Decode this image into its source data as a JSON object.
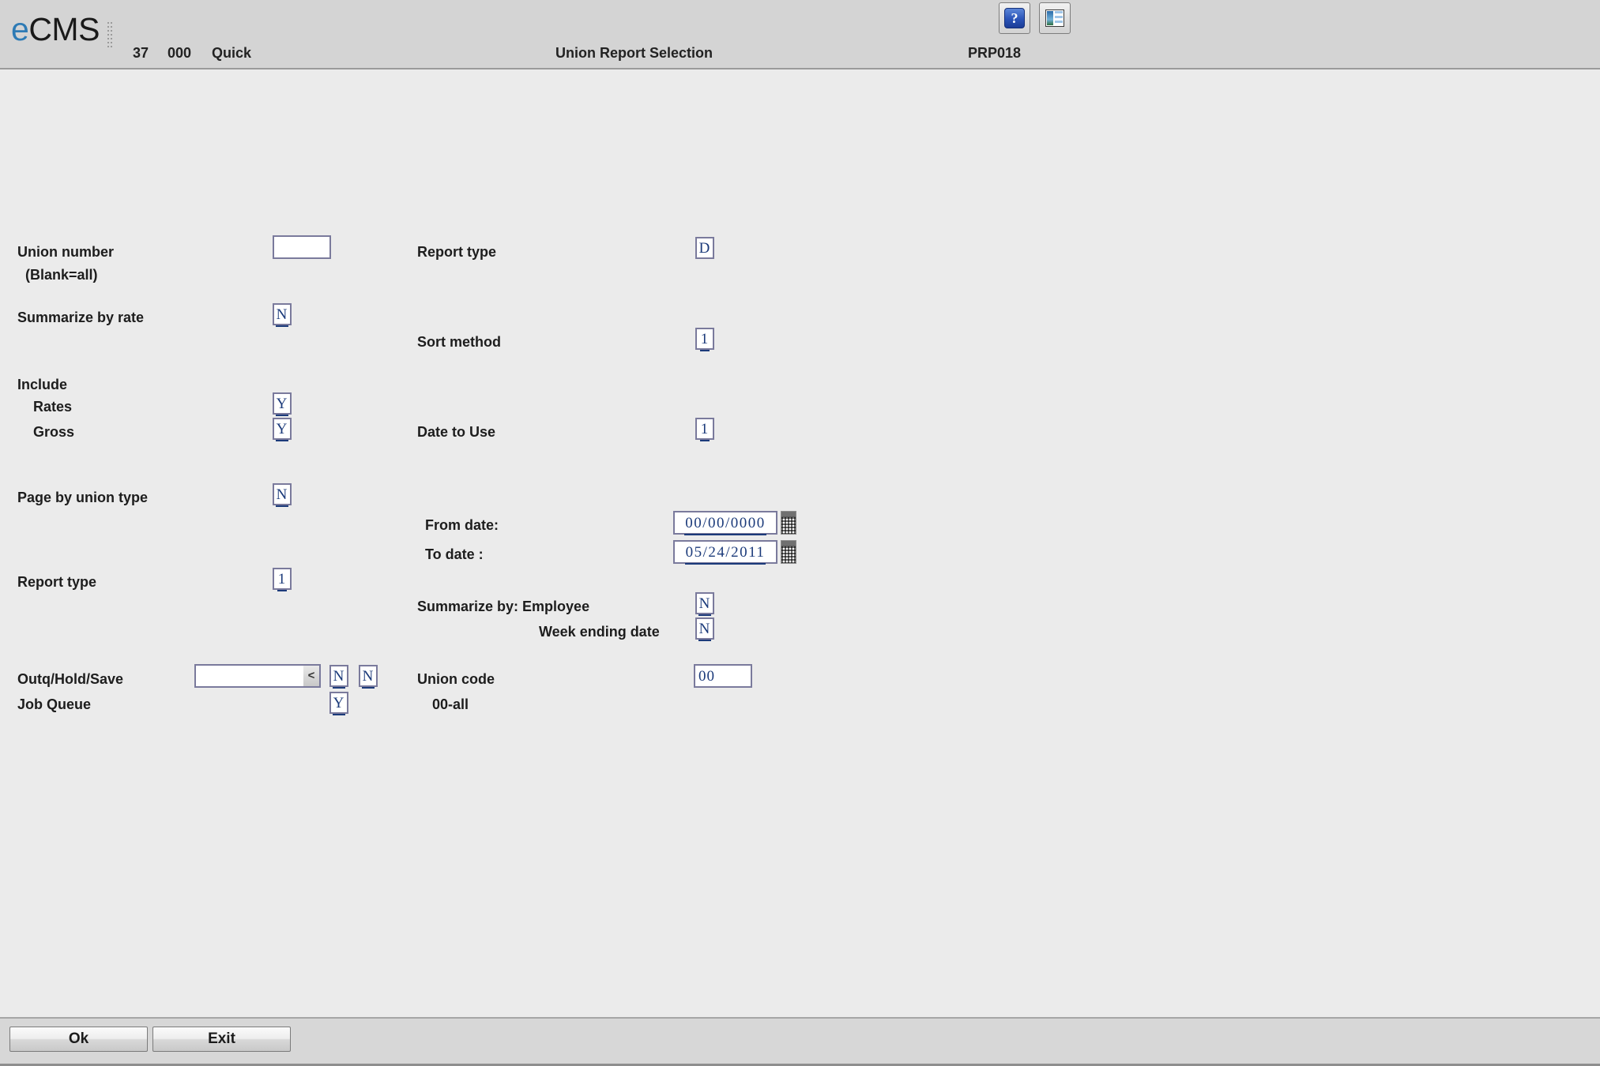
{
  "header": {
    "logo_e": "e",
    "logo_cms": "CMS",
    "company_number": "37",
    "division": "000",
    "user": "Quick",
    "title": "Union Report Selection",
    "program_id": "PRP018",
    "help_button": "?",
    "help_icon": "question-mark-icon",
    "window_icon": "split-window-icon"
  },
  "form": {
    "union_number_label": "Union number",
    "union_number_sub_label": "(Blank=all)",
    "union_number_value": "",
    "summarize_by_rate_label": "Summarize by rate",
    "summarize_by_rate_value": "N",
    "include_label": "Include",
    "include_rates_label": "Rates",
    "include_rates_value": "Y",
    "include_gross_label": "Gross",
    "include_gross_value": "Y",
    "page_by_union_type_label": "Page by union type",
    "page_by_union_type_value": "N",
    "report_type_left_label": "Report type",
    "report_type_left_value": "1",
    "outq_hold_save_label": "Outq/Hold/Save",
    "outq_value": "",
    "outq_prompt_glyph": "<",
    "hold_value": "N",
    "save_value": "N",
    "job_queue_label": "Job Queue",
    "job_queue_value": "Y",
    "report_type_right_label": "Report type",
    "report_type_right_value": "D",
    "sort_method_label": "Sort method",
    "sort_method_value": "1",
    "date_to_use_label": "Date to Use",
    "date_to_use_value": "1",
    "from_date_label": "From date:",
    "from_date_value": "00/00/0000",
    "to_date_label": "To date  :",
    "to_date_value": "05/24/2011",
    "summarize_by_employee_label": "Summarize by: Employee",
    "summarize_by_employee_value": "N",
    "week_ending_date_label": "Week ending date",
    "week_ending_date_value": "N",
    "union_code_label": "Union code",
    "union_code_value": "00",
    "union_code_hint": "00-all",
    "calendar_icon": "calendar-icon"
  },
  "footer": {
    "ok_label": "Ok",
    "exit_label": "Exit"
  },
  "colors": {
    "accent_blue": "#2e7bb5",
    "field_border": "#7a7a9c",
    "field_text": "#1b3a7a",
    "header_bg": "#d4d4d4",
    "body_bg": "#ebebeb"
  }
}
